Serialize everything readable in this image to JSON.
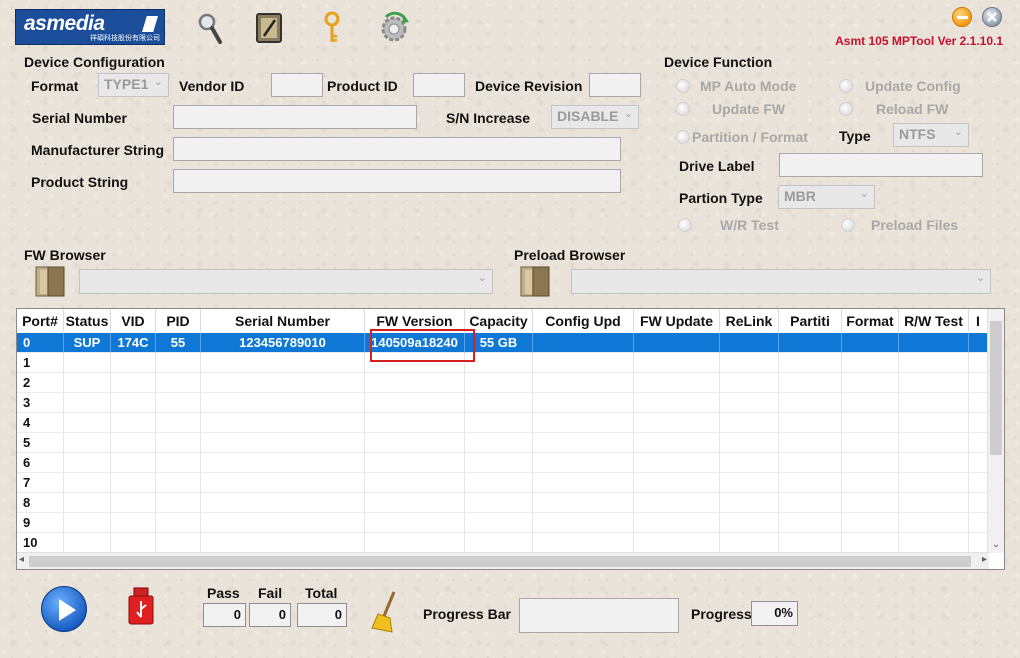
{
  "header": {
    "logo_text": "asmedia",
    "logo_sub": "祥碩科技股份有限公司",
    "version": "Asmt 105 MPTool Ver 2.1.10.1"
  },
  "toolbar": {
    "icons": [
      "magnifier-icon",
      "notepad-icon",
      "key-icon",
      "refresh-gear-icon"
    ]
  },
  "device_config": {
    "title": "Device Configuration",
    "format_label": "Format",
    "format_value": "TYPE1",
    "vendor_id_label": "Vendor ID",
    "vendor_id_value": "",
    "product_id_label": "Product ID",
    "product_id_value": "",
    "device_revision_label": "Device Revision",
    "device_revision_value": "",
    "serial_number_label": "Serial Number",
    "serial_number_value": "",
    "sn_increase_label": "S/N Increase",
    "sn_increase_value": "DISABLE",
    "manufacturer_label": "Manufacturer String",
    "manufacturer_value": "",
    "product_string_label": "Product String",
    "product_string_value": ""
  },
  "device_function": {
    "title": "Device Function",
    "mp_auto_mode": "MP Auto Mode",
    "update_config": "Update Config",
    "update_fw": "Update FW",
    "reload_fw": "Reload FW",
    "partition_format": "Partition / Format",
    "type_label": "Type",
    "type_value": "NTFS",
    "drive_label": "Drive Label",
    "drive_label_value": "",
    "partion_type_label": "Partion Type",
    "partion_type_value": "MBR",
    "wr_test": "W/R Test",
    "preload_files": "Preload Files"
  },
  "browsers": {
    "fw_browser": "FW Browser",
    "fw_value": "",
    "preload_browser": "Preload Browser",
    "preload_value": ""
  },
  "table": {
    "columns": [
      "Port#",
      "Status",
      "VID",
      "PID",
      "Serial Number",
      "FW Version",
      "Capacity",
      "Config Upd",
      "FW Update",
      "ReLink",
      "Partiti",
      "Format",
      "R/W Test",
      "I"
    ],
    "rows": [
      [
        "0",
        "SUP",
        "174C",
        "55",
        "123456789010",
        "140509a18240",
        "55 GB",
        "",
        "",
        "",
        "",
        "",
        "",
        ""
      ],
      [
        "1",
        "",
        "",
        "",
        "",
        "",
        "",
        "",
        "",
        "",
        "",
        "",
        "",
        ""
      ],
      [
        "2",
        "",
        "",
        "",
        "",
        "",
        "",
        "",
        "",
        "",
        "",
        "",
        "",
        ""
      ],
      [
        "3",
        "",
        "",
        "",
        "",
        "",
        "",
        "",
        "",
        "",
        "",
        "",
        "",
        ""
      ],
      [
        "4",
        "",
        "",
        "",
        "",
        "",
        "",
        "",
        "",
        "",
        "",
        "",
        "",
        ""
      ],
      [
        "5",
        "",
        "",
        "",
        "",
        "",
        "",
        "",
        "",
        "",
        "",
        "",
        "",
        ""
      ],
      [
        "6",
        "",
        "",
        "",
        "",
        "",
        "",
        "",
        "",
        "",
        "",
        "",
        "",
        ""
      ],
      [
        "7",
        "",
        "",
        "",
        "",
        "",
        "",
        "",
        "",
        "",
        "",
        "",
        "",
        ""
      ],
      [
        "8",
        "",
        "",
        "",
        "",
        "",
        "",
        "",
        "",
        "",
        "",
        "",
        "",
        ""
      ],
      [
        "9",
        "",
        "",
        "",
        "",
        "",
        "",
        "",
        "",
        "",
        "",
        "",
        "",
        ""
      ],
      [
        "10",
        "",
        "",
        "",
        "",
        "",
        "",
        "",
        "",
        "",
        "",
        "",
        "",
        ""
      ]
    ]
  },
  "bottom": {
    "pass_label": "Pass",
    "fail_label": "Fail",
    "total_label": "Total",
    "pass_value": "0",
    "fail_value": "0",
    "total_value": "0",
    "progress_bar_label": "Progress Bar",
    "progress_label": "Progress",
    "progress_value": "0%",
    "progress_fraction": 0
  },
  "colors": {
    "selection": "#0f78d7",
    "highlight_box": "#d42020",
    "version_text": "#c8102e",
    "logo_bg": "#1b4d9b"
  }
}
